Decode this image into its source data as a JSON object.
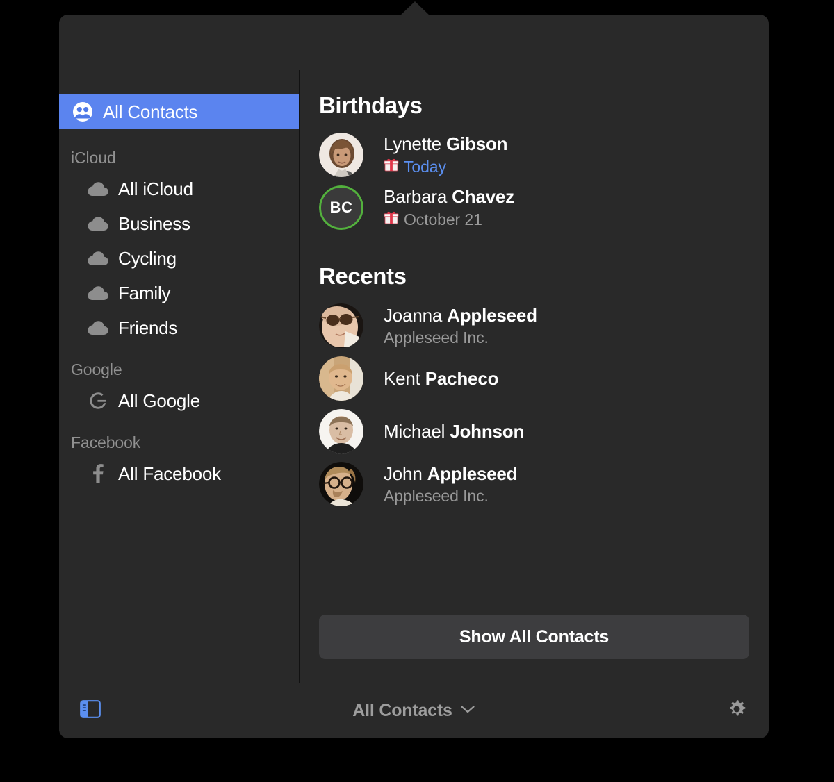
{
  "window": {
    "title": "Contacts Popover",
    "accent_blue": "#5b84ef",
    "panel_bg": "#292929",
    "selected_text": "#ffffff"
  },
  "sidebar": {
    "all_contacts": {
      "label": "All Contacts",
      "icon": "two-people-icon",
      "selected": true
    },
    "groups": [
      {
        "header": "iCloud",
        "items": [
          {
            "label": "All iCloud",
            "icon": "cloud-icon"
          },
          {
            "label": "Business",
            "icon": "cloud-icon"
          },
          {
            "label": "Cycling",
            "icon": "cloud-icon"
          },
          {
            "label": "Family",
            "icon": "cloud-icon"
          },
          {
            "label": "Friends",
            "icon": "cloud-icon"
          }
        ]
      },
      {
        "header": "Google",
        "items": [
          {
            "label": "All Google",
            "icon": "google-g-icon"
          }
        ]
      },
      {
        "header": "Facebook",
        "items": [
          {
            "label": "All Facebook",
            "icon": "facebook-f-icon"
          }
        ]
      }
    ]
  },
  "main": {
    "birthdays": {
      "title": "Birthdays",
      "people": [
        {
          "first": "Lynette",
          "last": "Gibson",
          "date": "Today",
          "date_is_today": true,
          "avatar_type": "photo",
          "icon": "gift-icon"
        },
        {
          "first": "Barbara",
          "last": "Chavez",
          "date": "October 21",
          "date_is_today": false,
          "avatar_type": "monogram",
          "monogram": "BC",
          "monogram_ring_color": "#53b13d",
          "icon": "gift-icon"
        }
      ]
    },
    "recents": {
      "title": "Recents",
      "people": [
        {
          "first": "Joanna",
          "last": "Appleseed",
          "company": "Appleseed Inc.",
          "avatar_type": "photo"
        },
        {
          "first": "Kent",
          "last": "Pacheco",
          "company": "",
          "avatar_type": "photo"
        },
        {
          "first": "Michael",
          "last": "Johnson",
          "company": "",
          "avatar_type": "photo"
        },
        {
          "first": "John",
          "last": "Appleseed",
          "company": "Appleseed Inc.",
          "avatar_type": "photo"
        }
      ]
    },
    "show_all_button": "Show All Contacts"
  },
  "toolbar": {
    "sidebar_toggle_icon": "sidebar-toggle-icon",
    "group_label": "All Contacts",
    "chevron_icon": "chevron-down-icon",
    "settings_icon": "gear-icon"
  }
}
